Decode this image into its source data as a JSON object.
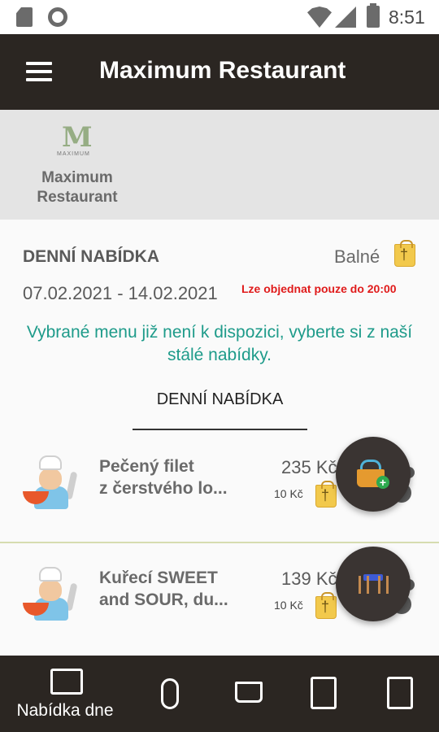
{
  "status_bar": {
    "time": "8:51"
  },
  "app_bar": {
    "title": "Maximum Restaurant"
  },
  "restaurant": {
    "logo_letter": "M",
    "logo_text": "MAXIMUM",
    "name": "Maximum Restaurant"
  },
  "daily_offer": {
    "heading": "DENNÍ NABÍDKA",
    "mode": "Balné",
    "date_range": "07.02.2021 - 14.02.2021",
    "order_deadline": "Lze objednat pouze do 20:00",
    "notice": "Vybrané menu již není k dispozici, vyberte si z naší stálé nabídky.",
    "tab_label": "DENNÍ NABÍDKA"
  },
  "menu_items": [
    {
      "name_line1": "Pečený filet",
      "name_line2": "z čerstvého lo...",
      "price": "235 Kč",
      "packaging": "10 Kč"
    },
    {
      "name_line1": "Kuřecí SWEET",
      "name_line2": "and SOUR, du...",
      "price": "139 Kč",
      "packaging": "10 Kč"
    }
  ],
  "fabs": {
    "cart": "basket-add-icon",
    "table": "table-reservation-icon"
  },
  "bottom_nav": {
    "active_label": "Nabídka dne",
    "items": [
      "menu-book-icon",
      "cutlery-icon",
      "cart-icon",
      "list-icon",
      "receipt-icon"
    ]
  },
  "colors": {
    "bar": "#2b2622",
    "notice": "#1e9b8a",
    "deadline": "#e01b1b",
    "separator": "#d6dcb0"
  }
}
